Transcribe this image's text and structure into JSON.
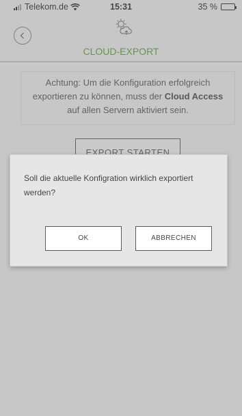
{
  "status_bar": {
    "carrier": "Telekom.de",
    "time": "15:31",
    "battery_text": "35 %",
    "battery_level": 0.35
  },
  "header": {
    "title": "CLOUD-EXPORT",
    "back_icon": "chevron-left-icon",
    "header_icon": "cloud-gear-icon",
    "accent_color": "#4a9a1f"
  },
  "notice": {
    "text_before": "Achtung: Um die Konfiguration erfolgreich exportieren zu können, muss der ",
    "text_bold": "Cloud Access",
    "text_after": " auf allen Servern aktiviert sein."
  },
  "export_button": {
    "label": "EXPORT STARTEN"
  },
  "dialog": {
    "message": "Soll die aktuelle Konfigration wirklich exportiert werden?",
    "ok_label": "OK",
    "cancel_label": "ABBRECHEN"
  }
}
